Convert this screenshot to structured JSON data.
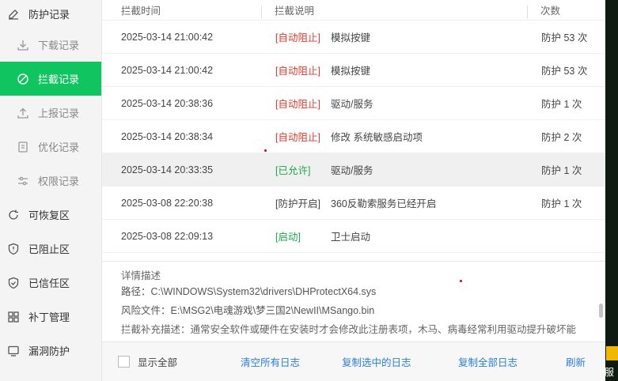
{
  "sidebar": {
    "items": [
      {
        "label": "防护记录",
        "icon": "edit-icon",
        "sub": false,
        "active": false
      },
      {
        "label": "下载记录",
        "icon": "download-icon",
        "sub": true,
        "active": false
      },
      {
        "label": "拦截记录",
        "icon": "block-icon",
        "sub": true,
        "active": true
      },
      {
        "label": "上报记录",
        "icon": "upload-icon",
        "sub": true,
        "active": false
      },
      {
        "label": "优化记录",
        "icon": "document-icon",
        "sub": true,
        "active": false
      },
      {
        "label": "权限记录",
        "icon": "sliders-icon",
        "sub": true,
        "active": false
      },
      {
        "label": "可恢复区",
        "icon": "restore-icon",
        "sub": false,
        "active": false
      },
      {
        "label": "已阻止区",
        "icon": "shield-alert-icon",
        "sub": false,
        "active": false
      },
      {
        "label": "已信任区",
        "icon": "shield-check-icon",
        "sub": false,
        "active": false
      },
      {
        "label": "补丁管理",
        "icon": "grid-icon",
        "sub": false,
        "active": false
      },
      {
        "label": "漏洞防护",
        "icon": "monitor-icon",
        "sub": false,
        "active": false
      }
    ]
  },
  "table": {
    "headers": {
      "time": "拦截时间",
      "desc": "拦截说明",
      "count": "次数"
    },
    "rows": [
      {
        "time": "2025-03-14 21:00:42",
        "tag": "[自动阻止]",
        "tag_color": "red",
        "desc": "模拟按键",
        "count": "防护 53 次"
      },
      {
        "time": "2025-03-14 21:00:42",
        "tag": "[自动阻止]",
        "tag_color": "red",
        "desc": "模拟按键",
        "count": "防护 53 次"
      },
      {
        "time": "2025-03-14 20:38:36",
        "tag": "[自动阻止]",
        "tag_color": "red",
        "desc": "驱动/服务",
        "count": "防护 1 次"
      },
      {
        "time": "2025-03-14 20:38:34",
        "tag": "[自动阻止]",
        "tag_color": "red",
        "desc": "修改 系统敏感启动项",
        "count": "防护 2 次"
      },
      {
        "time": "2025-03-14 20:33:35",
        "tag": "[已允许]",
        "tag_color": "green",
        "desc": "驱动/服务",
        "count": "防护 1 次",
        "selected": true
      },
      {
        "time": "2025-03-08 22:20:38",
        "tag": "[防护开启]",
        "tag_color": "gray",
        "desc": "360反勒索服务已经开启",
        "count": "防护 1 次"
      },
      {
        "time": "2025-03-08 22:09:13",
        "tag": "[启动]",
        "tag_color": "green",
        "desc": "卫士启动",
        "count": ""
      }
    ]
  },
  "details": {
    "heading": "详情描述",
    "path": "路径：C:\\WINDOWS\\System32\\drivers\\DHProtectX64.sys",
    "risk_file": "风险文件：E:\\MSG2\\电魂游戏\\梦三国2\\NewII\\MSango.bin",
    "note": "拦截补充描述：通常安全软件或硬件在安装时才会修改此注册表项，木马、病毒经常利用驱动提升破坏能"
  },
  "footer": {
    "show_all": "显示全部",
    "clear_all": "清空所有日志",
    "copy_selected": "复制选中的日志",
    "copy_all": "复制全部日志",
    "refresh": "刷新"
  },
  "edge": {
    "text": "服"
  },
  "colors": {
    "accent": "#10c560",
    "red": "#e03a2f",
    "green": "#1aa84a",
    "link": "#2a7fd4"
  }
}
